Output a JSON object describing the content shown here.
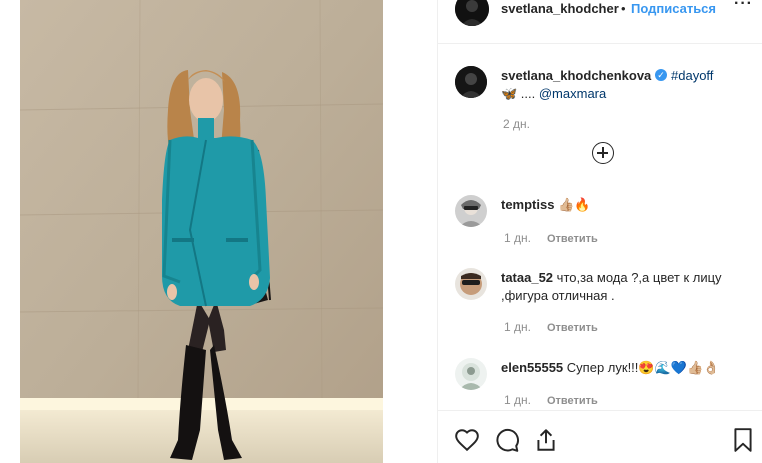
{
  "header": {
    "username": "svetlana_khodcher",
    "dot": "•",
    "follow_label": "Подписаться",
    "more_label": "···"
  },
  "caption": {
    "username": "svetlana_khodchenkova",
    "verified_icon": "verified-badge-icon",
    "hashtag": "#dayoff",
    "line2_emoji": "🦋",
    "line2_dots": " .... ",
    "mention": "@maxmara",
    "time": "2 дн."
  },
  "comments": [
    {
      "username": "temptiss",
      "text": "👍🏼🔥",
      "time": "1 дн.",
      "reply_label": "Ответить"
    },
    {
      "username": "tataa_52",
      "text": "что,за мода ?,а цвет к лицу ,фигура отличная .",
      "time": "1 дн.",
      "reply_label": "Ответить"
    },
    {
      "username": "elen55555",
      "text": "Супер лук!!!😍🌊💙👍🏼👌🏼",
      "time": "1 дн.",
      "reply_label": "Ответить"
    }
  ],
  "colors": {
    "accent": "#3897f0",
    "link": "#00376b",
    "muted": "#8e8e8e",
    "coat": "#1f9aa8"
  },
  "icons": [
    "heart-icon",
    "comment-icon",
    "share-icon",
    "bookmark-icon",
    "plus-circle-icon"
  ]
}
